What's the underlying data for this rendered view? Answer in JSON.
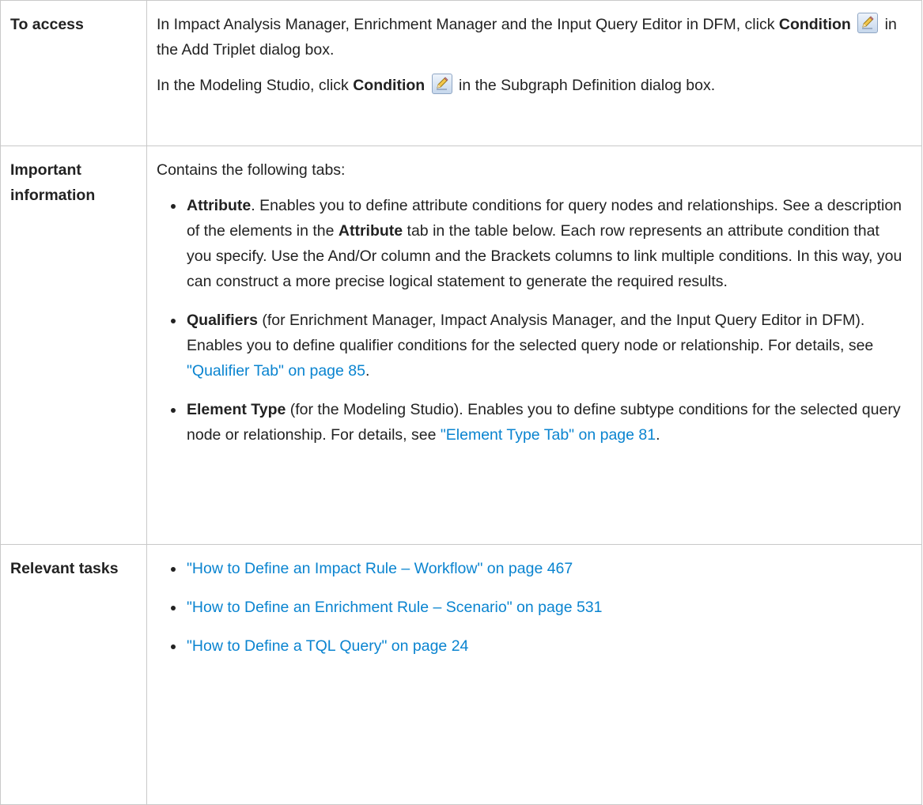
{
  "table": {
    "to_access": {
      "label": "To access",
      "p1": {
        "before": "In Impact Analysis Manager, Enrichment Manager and the Input Query Editor in DFM, click ",
        "bold": "Condition",
        "after": " in the Add Triplet dialog box."
      },
      "p2": {
        "before": "In the Modeling Studio, click ",
        "bold": "Condition",
        "after": " in the Subgraph Definition dialog box."
      },
      "icon": "pencil-icon"
    },
    "important": {
      "label": "Important information",
      "intro": "Contains the following tabs:",
      "items": [
        {
          "bold": "Attribute",
          "text_a": ". Enables you to define attribute conditions for query nodes and relationships. See a description of the elements in the ",
          "bold2": "Attribute",
          "text_b": " tab in the table below. Each row represents an attribute condition that you specify. Use the And/Or column and the Brackets columns to link multiple conditions. In this way, you can construct a more precise logical statement to generate the required results."
        },
        {
          "bold": "Qualifiers",
          "text": " (for Enrichment Manager, Impact Analysis Manager, and the Input Query Editor in DFM). Enables you to define qualifier conditions for the selected query node or relationship. For details, see ",
          "link": "\"Qualifier Tab\" on page 85",
          "end": "."
        },
        {
          "bold": "Element Type",
          "text": " (for the Modeling Studio). Enables you to define subtype conditions for the selected query node or relationship. For details, see ",
          "link": "\"Element Type Tab\" on page 81",
          "end": "."
        }
      ]
    },
    "tasks": {
      "label": "Relevant tasks",
      "links": [
        "\"How to Define an Impact Rule – Workflow\" on page 467",
        "\"How to Define an Enrichment Rule – Scenario\" on page 531",
        "\"How to Define a TQL Query\" on page 24"
      ]
    }
  }
}
